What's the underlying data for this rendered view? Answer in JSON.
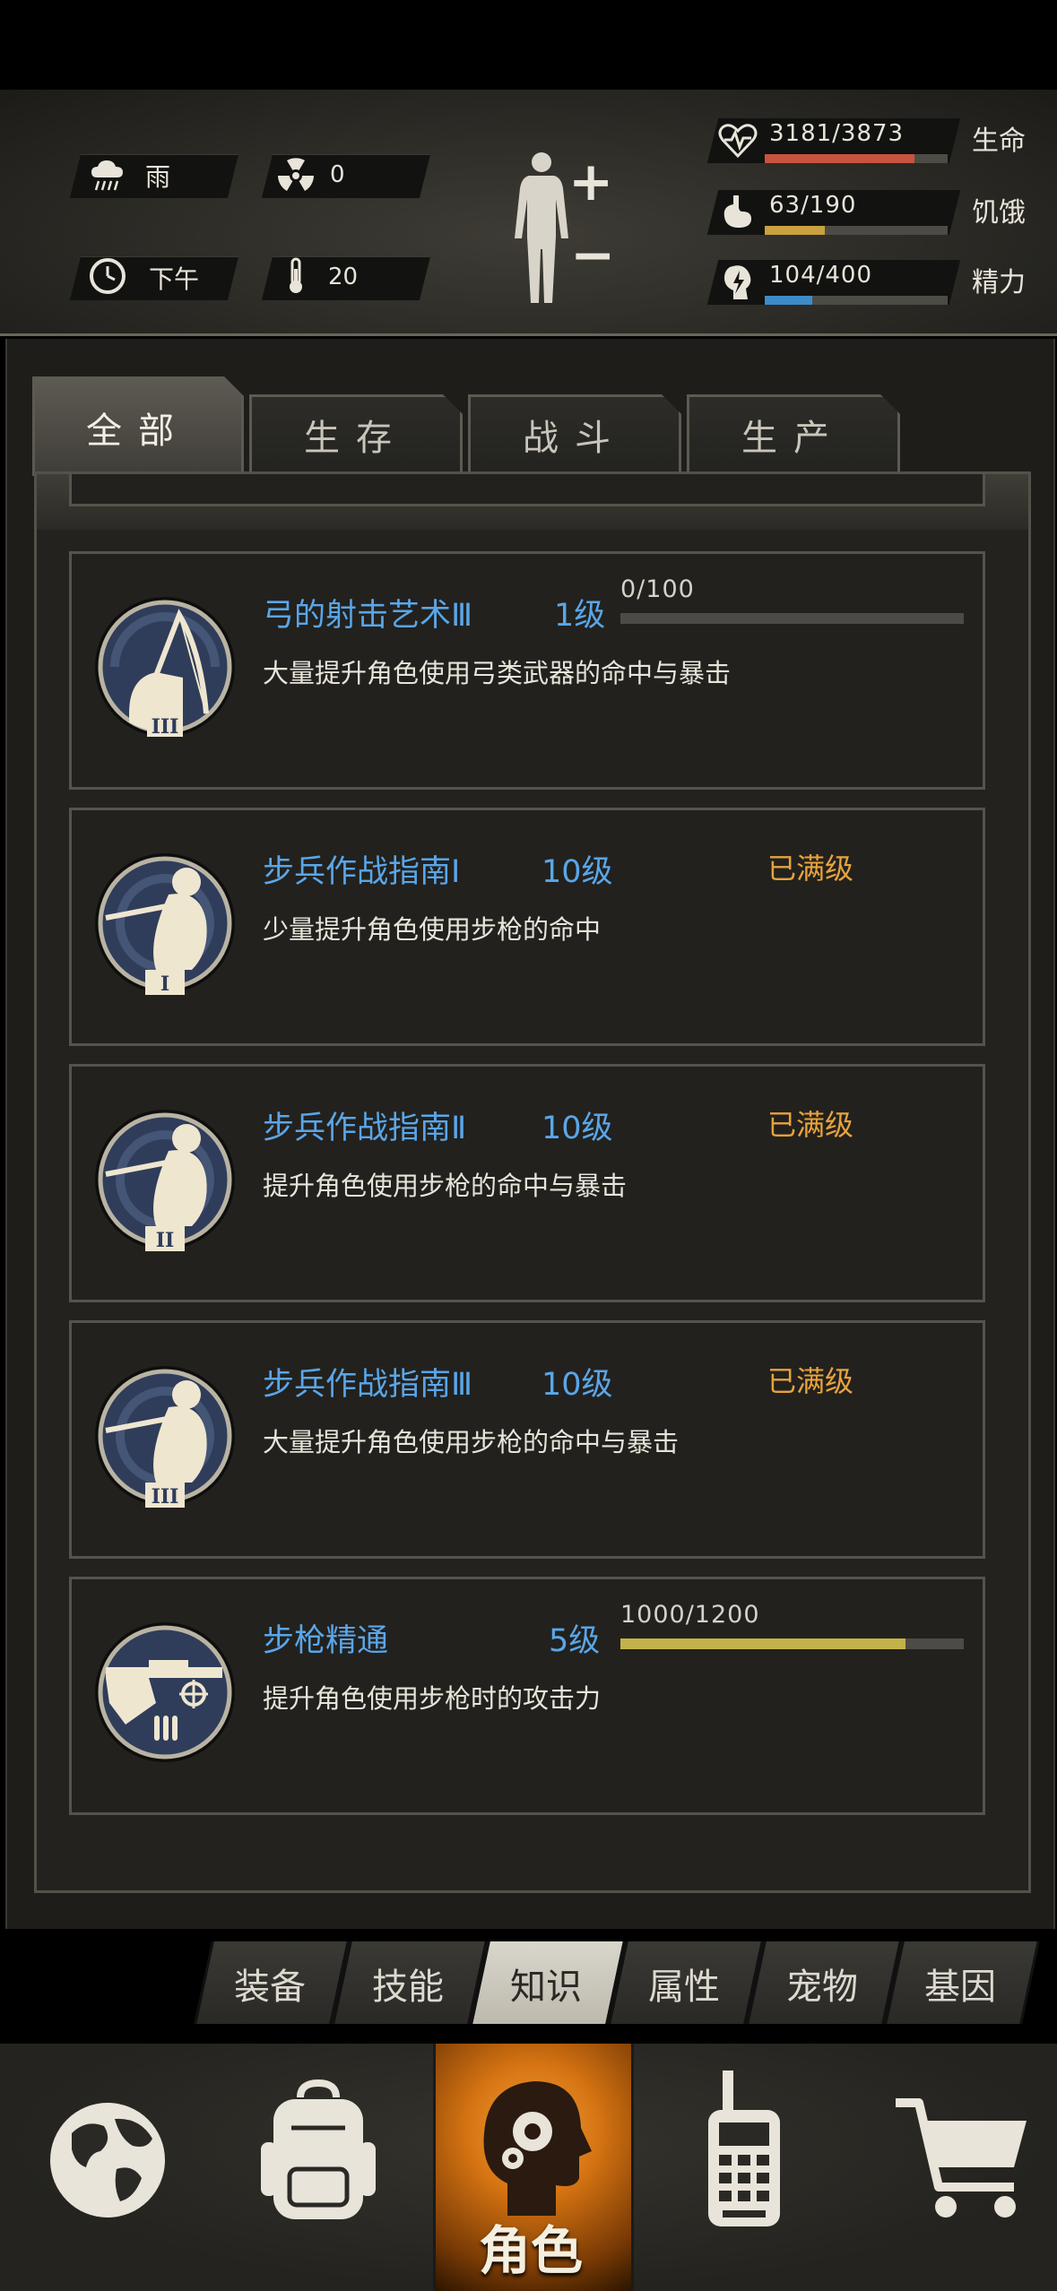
{
  "status": {
    "weather": {
      "icon": "rain-cloud-icon",
      "label": "雨"
    },
    "radiation": {
      "icon": "radiation-icon",
      "value": "0"
    },
    "time": {
      "icon": "clock-icon",
      "label": "下午"
    },
    "temperature": {
      "icon": "thermometer-icon",
      "value": "20"
    }
  },
  "body_controls": {
    "plus": "+",
    "minus": "−"
  },
  "vitals": [
    {
      "icon": "heart-pulse-icon",
      "value": "3181/3873",
      "label": "生命",
      "fraction": 0.82,
      "color": "#c9533e"
    },
    {
      "icon": "stomach-icon",
      "value": "63/190",
      "label": "饥饿",
      "fraction": 0.33,
      "color": "#c9a13e"
    },
    {
      "icon": "energy-icon",
      "value": "104/400",
      "label": "精力",
      "fraction": 0.26,
      "color": "#3e8bc9"
    }
  ],
  "tabs": [
    {
      "label": "全部",
      "active": true
    },
    {
      "label": "生存",
      "active": false
    },
    {
      "label": "战斗",
      "active": false
    },
    {
      "label": "生产",
      "active": false
    }
  ],
  "skills": [
    {
      "name": "弓的射击艺术Ⅲ",
      "level": "1级",
      "desc": "大量提升角色使用弓类武器的命中与暴击",
      "progress_text": "0/100",
      "progress": 0.0,
      "emblem": "bow",
      "numeral": "III"
    },
    {
      "name": "步兵作战指南Ⅰ",
      "level": "10级",
      "desc": "少量提升角色使用步枪的命中",
      "max_text": "已满级",
      "emblem": "rifleman",
      "numeral": "I"
    },
    {
      "name": "步兵作战指南Ⅱ",
      "level": "10级",
      "desc": "提升角色使用步枪的命中与暴击",
      "max_text": "已满级",
      "emblem": "rifleman",
      "numeral": "II"
    },
    {
      "name": "步兵作战指南Ⅲ",
      "level": "10级",
      "desc": "大量提升角色使用步枪的命中与暴击",
      "max_text": "已满级",
      "emblem": "rifleman",
      "numeral": "III"
    },
    {
      "name": "步枪精通",
      "level": "5级",
      "desc": "提升角色使用步枪时的攻击力",
      "progress_text": "1000/1200",
      "progress": 0.83,
      "emblem": "rifle",
      "numeral": ""
    }
  ],
  "subtabs": [
    {
      "label": "装备",
      "active": false
    },
    {
      "label": "技能",
      "active": false
    },
    {
      "label": "知识",
      "active": true
    },
    {
      "label": "属性",
      "active": false
    },
    {
      "label": "宠物",
      "active": false
    },
    {
      "label": "基因",
      "active": false
    }
  ],
  "bottom_nav": [
    {
      "icon": "globe-icon"
    },
    {
      "icon": "backpack-icon"
    },
    {
      "icon": "head-gear-icon",
      "label": "角色",
      "active": true
    },
    {
      "icon": "radio-icon"
    },
    {
      "icon": "cart-icon"
    }
  ]
}
